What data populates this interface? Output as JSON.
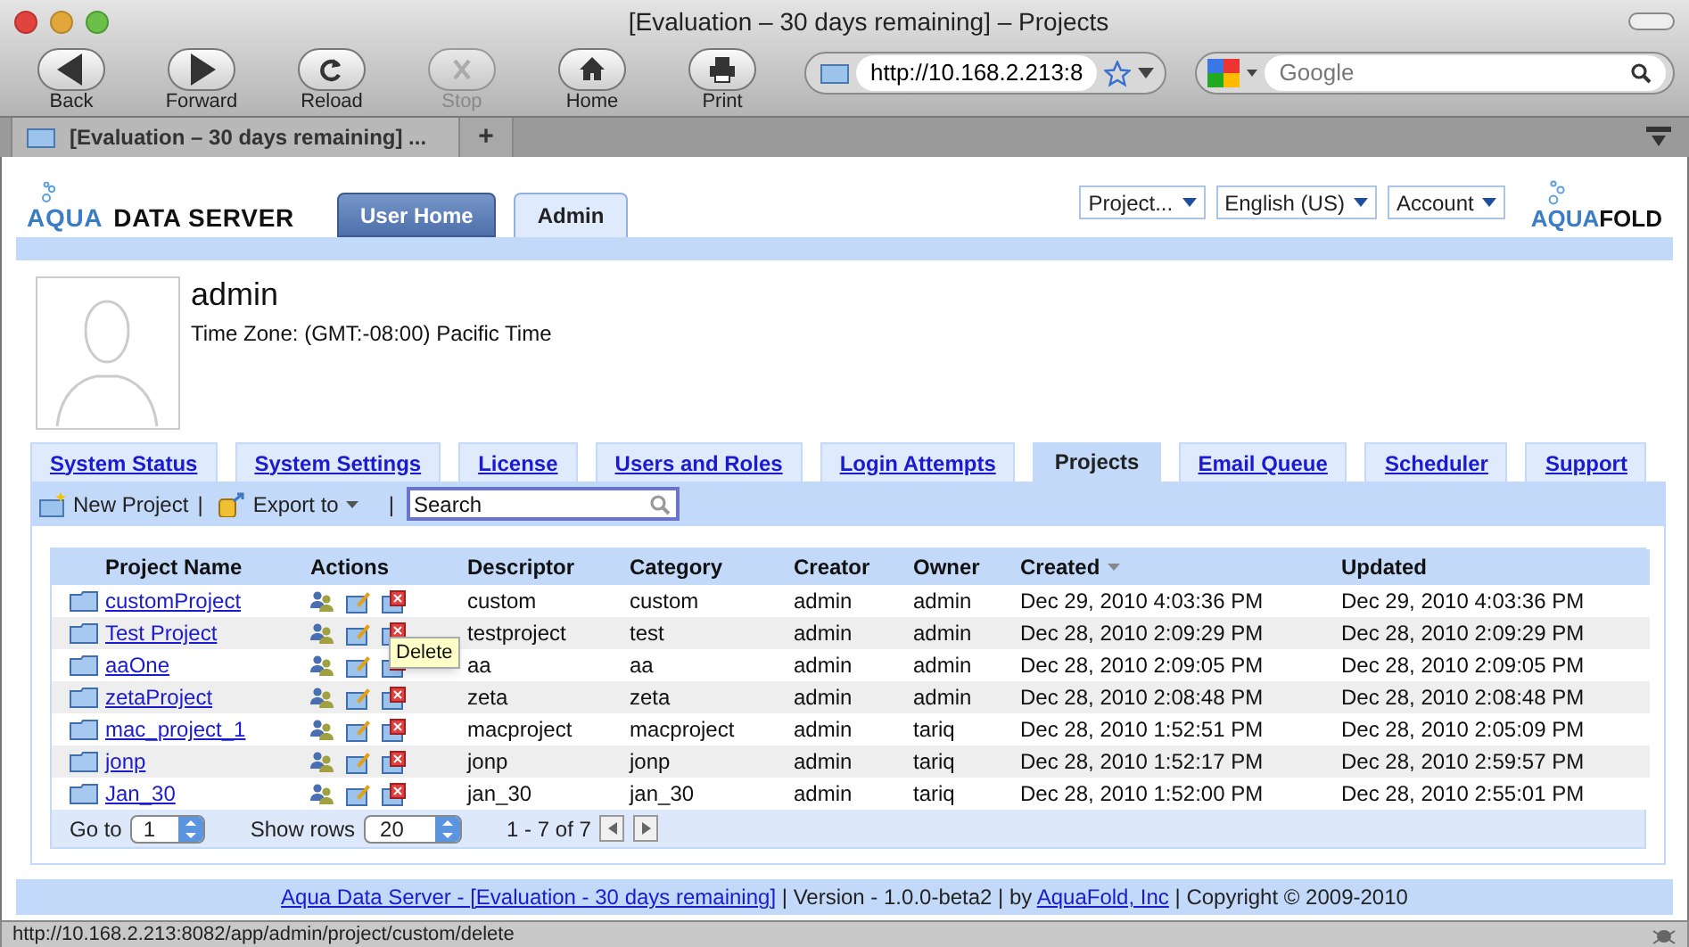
{
  "browser": {
    "title": "[Evaluation – 30 days remaining] – Projects",
    "nav_buttons": [
      {
        "kind": "back",
        "label": "Back",
        "disabled": false
      },
      {
        "kind": "forward",
        "label": "Forward",
        "disabled": false
      },
      {
        "kind": "reload",
        "label": "Reload",
        "disabled": false
      },
      {
        "kind": "stop",
        "label": "Stop",
        "disabled": true
      },
      {
        "kind": "home",
        "label": "Home",
        "disabled": false
      },
      {
        "kind": "print",
        "label": "Print",
        "disabled": false
      }
    ],
    "url": "http://10.168.2.213:8",
    "search_placeholder": "Google",
    "tab_title": "[Evaluation – 30 days remaining] ...",
    "new_tab": "+",
    "status_url": "http://10.168.2.213:8082/app/admin/project/custom/delete"
  },
  "header": {
    "logo_left": [
      "AQUA",
      "DATA SERVER"
    ],
    "logo_right": [
      "AQUA",
      "FOLD"
    ],
    "tabs": [
      {
        "label": "User Home",
        "selected": false
      },
      {
        "label": "Admin",
        "selected": true
      }
    ],
    "menus": [
      "Project...",
      "English (US)",
      "Account"
    ]
  },
  "user": {
    "name": "admin",
    "timezone": "Time Zone: (GMT:-08:00) Pacific Time"
  },
  "admin_tabs": [
    {
      "label": "System Status",
      "selected": false
    },
    {
      "label": "System Settings",
      "selected": false
    },
    {
      "label": "License",
      "selected": false
    },
    {
      "label": "Users and Roles",
      "selected": false
    },
    {
      "label": "Login Attempts",
      "selected": false
    },
    {
      "label": "Projects",
      "selected": true
    },
    {
      "label": "Email Queue",
      "selected": false
    },
    {
      "label": "Scheduler",
      "selected": false
    },
    {
      "label": "Support",
      "selected": false
    }
  ],
  "toolbar": {
    "new_project": "New Project",
    "separator": "|",
    "export": "Export to",
    "separator_2": "|",
    "search": "Search"
  },
  "table": {
    "columns": [
      {
        "label": "Project Name",
        "sorted": false
      },
      {
        "label": "Actions",
        "sorted": false
      },
      {
        "label": "Descriptor",
        "sorted": false
      },
      {
        "label": "Category",
        "sorted": false
      },
      {
        "label": "Creator",
        "sorted": false
      },
      {
        "label": "Owner",
        "sorted": false
      },
      {
        "label": "Created",
        "sorted": true
      },
      {
        "label": "Updated",
        "sorted": false
      }
    ],
    "rows": [
      {
        "name": "customProject",
        "descriptor": "custom",
        "category": "custom",
        "creator": "admin",
        "owner": "admin",
        "created": "Dec 29, 2010 4:03:36 PM",
        "updated": "Dec 29, 2010 4:03:36 PM"
      },
      {
        "name": "Test Project",
        "descriptor": "testproject",
        "category": "test",
        "creator": "admin",
        "owner": "admin",
        "created": "Dec 28, 2010 2:09:29 PM",
        "updated": "Dec 28, 2010 2:09:29 PM"
      },
      {
        "name": "aaOne",
        "descriptor": "aa",
        "category": "aa",
        "creator": "admin",
        "owner": "admin",
        "created": "Dec 28, 2010 2:09:05 PM",
        "updated": "Dec 28, 2010 2:09:05 PM"
      },
      {
        "name": "zetaProject",
        "descriptor": "zeta",
        "category": "zeta",
        "creator": "admin",
        "owner": "admin",
        "created": "Dec 28, 2010 2:08:48 PM",
        "updated": "Dec 28, 2010 2:08:48 PM"
      },
      {
        "name": "mac_project_1",
        "descriptor": "macproject",
        "category": "macproject",
        "creator": "admin",
        "owner": "tariq",
        "created": "Dec 28, 2010 1:52:51 PM",
        "updated": "Dec 28, 2010 2:05:09 PM"
      },
      {
        "name": "jonp",
        "descriptor": "jonp",
        "category": "jonp",
        "creator": "admin",
        "owner": "tariq",
        "created": "Dec 28, 2010 1:52:17 PM",
        "updated": "Dec 28, 2010 2:59:57 PM"
      },
      {
        "name": "Jan_30",
        "descriptor": "jan_30",
        "category": "jan_30",
        "creator": "admin",
        "owner": "tariq",
        "created": "Dec 28, 2010 1:52:00 PM",
        "updated": "Dec 28, 2010 2:55:01 PM"
      }
    ]
  },
  "tooltip": "Delete",
  "pager": {
    "goto_label": "Go to",
    "goto_value": "1",
    "rows_label": "Show rows",
    "rows_value": "20",
    "range": "1 - 7 of 7"
  },
  "footer": {
    "link": "Aqua Data Server - [Evaluation - 30 days remaining]",
    "version": " | Version - 1.0.0-beta2 | by ",
    "company_link": "AquaFold, Inc",
    "copyright": " | Copyright © 2009-2010"
  }
}
